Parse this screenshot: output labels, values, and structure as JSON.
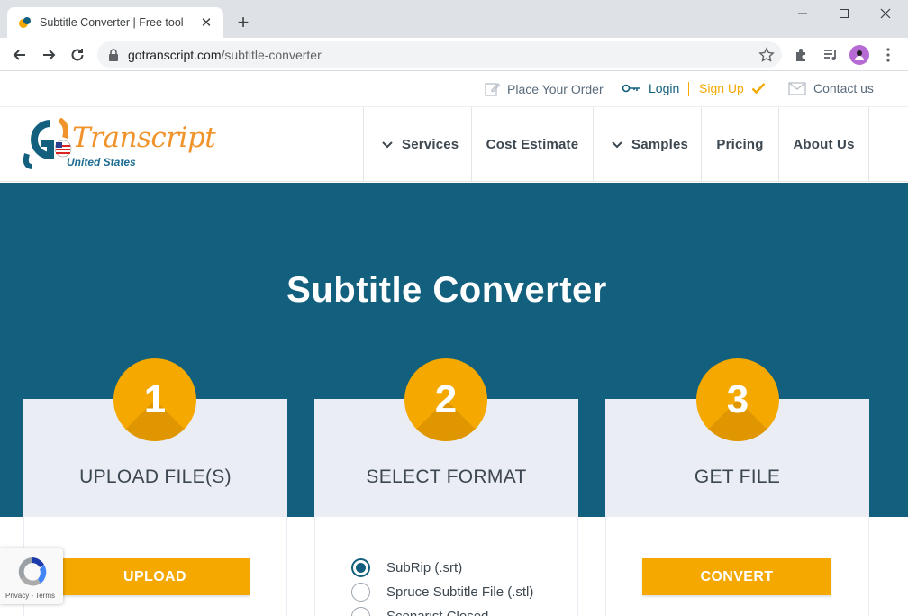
{
  "browser": {
    "tab_title": "Subtitle Converter | Free tool",
    "url_host": "gotranscript.com",
    "url_path": "/subtitle-converter"
  },
  "utility": {
    "place_order": "Place Your Order",
    "login": "Login",
    "signup": "Sign Up",
    "contact": "Contact us"
  },
  "logo": {
    "word": "Transcript",
    "region": "United States"
  },
  "nav": {
    "items": [
      {
        "label": "Services",
        "dropdown": true
      },
      {
        "label": "Cost Estimate",
        "dropdown": false
      },
      {
        "label": "Samples",
        "dropdown": true
      },
      {
        "label": "Pricing",
        "dropdown": false
      },
      {
        "label": "About Us",
        "dropdown": false
      }
    ]
  },
  "hero": {
    "title": "Subtitle Converter"
  },
  "steps": [
    {
      "number": "1",
      "heading": "UPLOAD FILE(S)",
      "button": "UPLOAD"
    },
    {
      "number": "2",
      "heading": "SELECT FORMAT"
    },
    {
      "number": "3",
      "heading": "GET FILE",
      "button": "CONVERT"
    }
  ],
  "formats": [
    {
      "label": "SubRip (.srt)",
      "checked": true
    },
    {
      "label": "Spruce Subtitle File (.stl)",
      "checked": false
    },
    {
      "label": "Scenarist Closed",
      "checked": false
    }
  ],
  "recaptcha": {
    "privacy": "Privacy",
    "terms": "Terms"
  },
  "colors": {
    "brand_blue": "#12607e",
    "brand_orange": "#f5a800"
  }
}
